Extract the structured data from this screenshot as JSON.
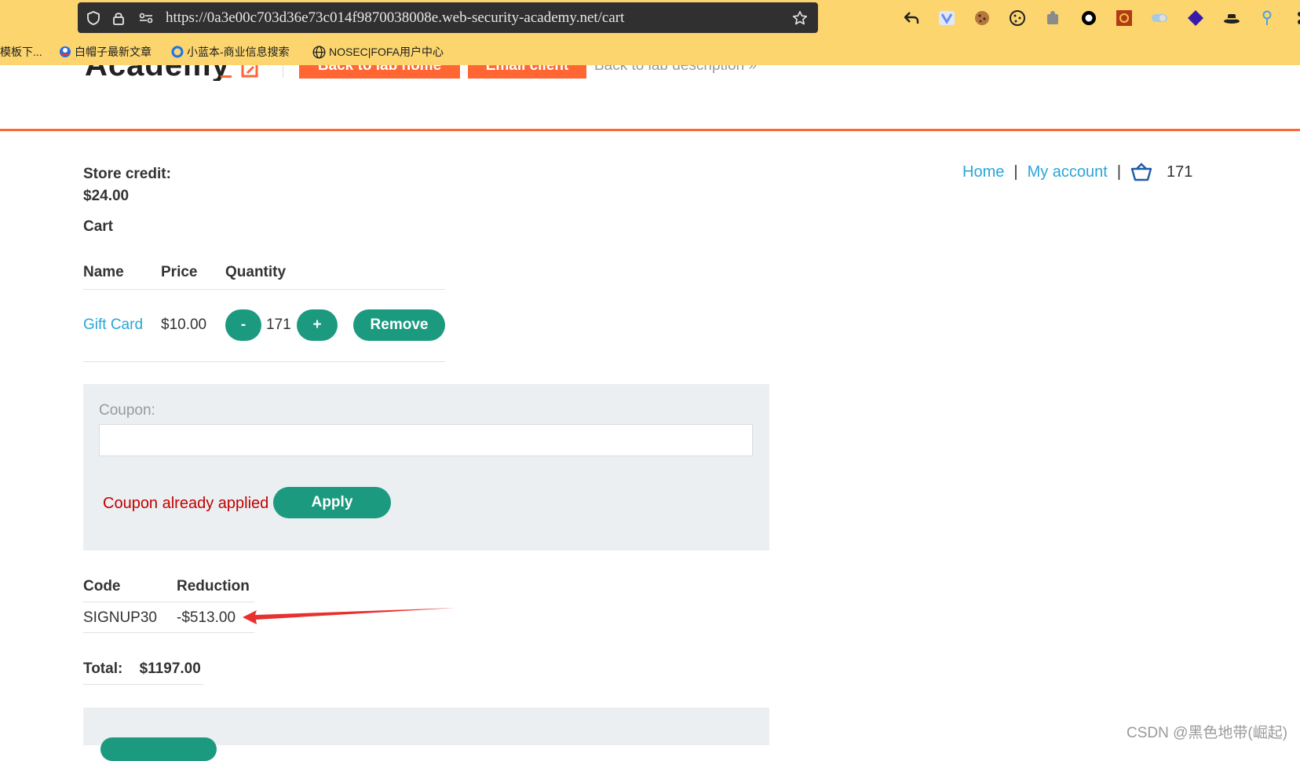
{
  "browser": {
    "url": "https://0a3e00c703d36e73c014f9870038008e.web-security-academy.net/cart",
    "bookmarks": [
      "模板下...",
      "白帽子最新文章",
      "小蓝本-商业信息搜索",
      "NOSEC|FOFA用户中心"
    ]
  },
  "lab_header": {
    "logo": "Academy",
    "back_to_lab_home": "Back to lab home",
    "email_client": "Email client",
    "back_to_description": "Back to lab description »"
  },
  "store_credit": {
    "label": "Store credit:",
    "value": "$24.00"
  },
  "nav": {
    "home": "Home",
    "separator": "|",
    "my_account": "My account",
    "cart_count": "171"
  },
  "cart": {
    "heading": "Cart",
    "columns": [
      "Name",
      "Price",
      "Quantity"
    ],
    "items": [
      {
        "name": "Gift Card",
        "price": "$10.00",
        "quantity": "171",
        "minus": "-",
        "plus": "+",
        "remove": "Remove"
      }
    ]
  },
  "coupon": {
    "label": "Coupon:",
    "value": "",
    "message": "Coupon already applied",
    "apply": "Apply"
  },
  "codes": {
    "columns": [
      "Code",
      "Reduction"
    ],
    "rows": [
      {
        "code": "SIGNUP30",
        "reduction": "-$513.00"
      }
    ]
  },
  "total": {
    "label": "Total:",
    "value": "$1197.00"
  },
  "watermark": "CSDN @黑色地带(崛起)",
  "colors": {
    "accent": "#ff6633",
    "button": "#1b9a80",
    "link": "#29a5d8",
    "error": "#c00000",
    "annotation_arrow": "#e8312f"
  }
}
